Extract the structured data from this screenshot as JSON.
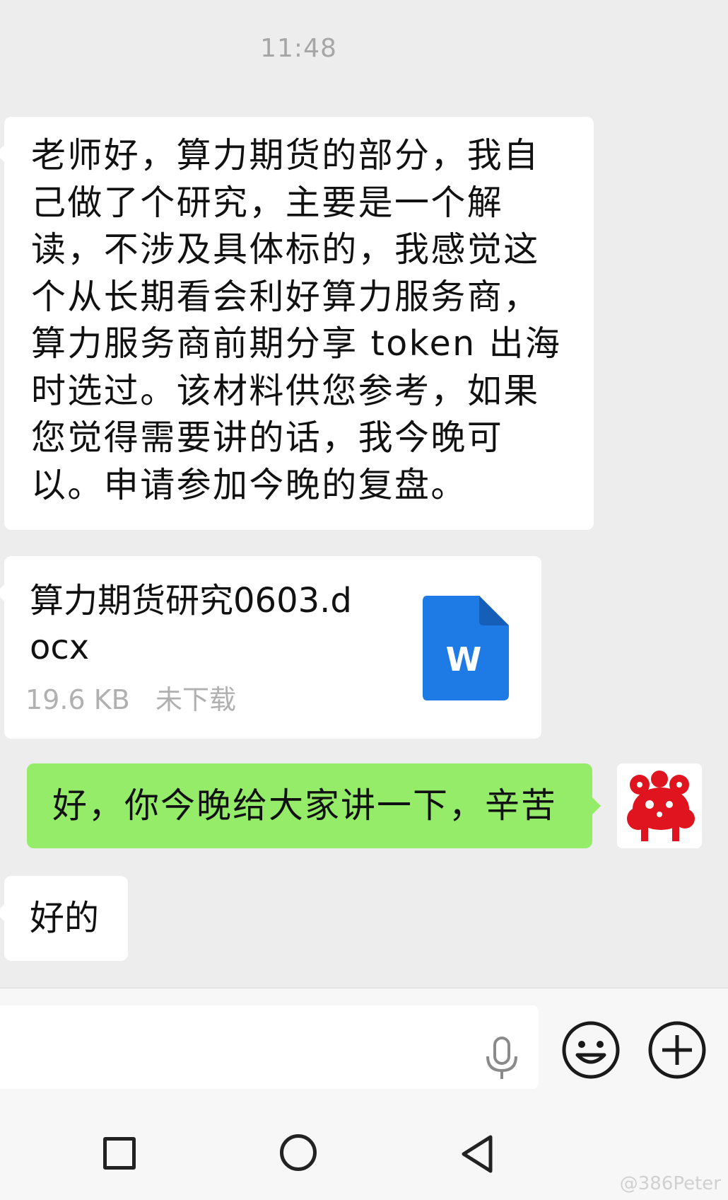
{
  "status_time": "11:48",
  "messages": {
    "incoming_text": "老师好，算力期货的部分，我自己做了个研究，主要是一个解读，不涉及具体标的，我感觉这个从长期看会利好算力服务商，算力服务商前期分享 token 出海时选过。该材料供您参考，如果您觉得需要讲的话，我今晚可以。申请参加今晚的复盘。",
    "file": {
      "name": "算力期货研究0603.docx",
      "size": "19.6 KB",
      "status": "未下载",
      "icon_letter": "W",
      "icon_color": "#1e7be6"
    },
    "outgoing_text": "好，你今晚给大家讲一下，辛苦",
    "incoming_reply": "好的"
  },
  "colors": {
    "background": "#ededed",
    "outgoing_bubble": "#95ec69",
    "incoming_bubble": "#ffffff",
    "avatar_red": "#e0141e"
  },
  "input_bar": {
    "icons": [
      "microphone-icon",
      "emoji-icon",
      "plus-icon"
    ]
  },
  "navbar": {
    "icons": [
      "recent-apps-icon",
      "home-icon",
      "back-icon"
    ]
  },
  "watermark": "@386Peter"
}
